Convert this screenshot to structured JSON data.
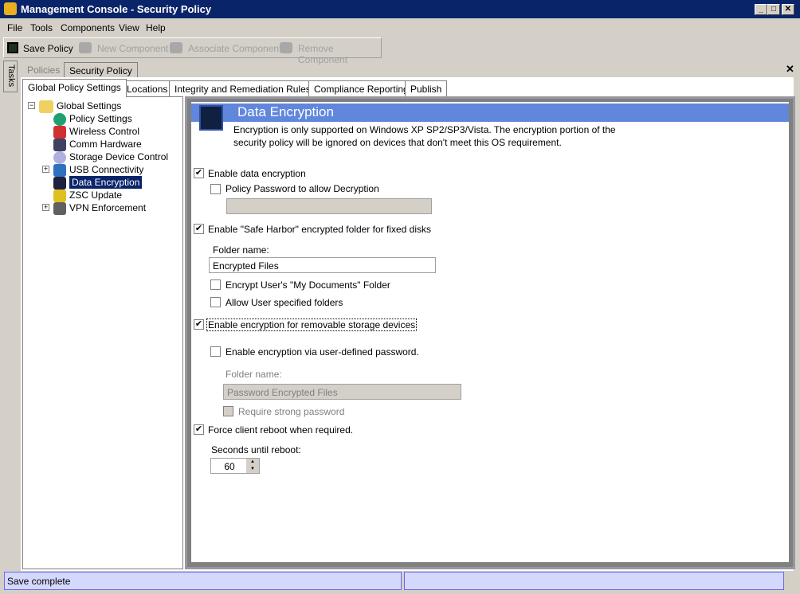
{
  "window": {
    "title": "Management Console - Security Policy"
  },
  "menu": [
    "File",
    "Tools",
    "Components",
    "View",
    "Help"
  ],
  "toolbar": {
    "save": "Save Policy",
    "new": "New Component",
    "associate": "Associate Component",
    "remove": "Remove Component"
  },
  "tasks_label": "Tasks",
  "doc_tabs": [
    "Policies",
    "Security Policy"
  ],
  "sub_tabs": [
    "Global Policy Settings",
    "Locations",
    "Integrity and Remediation Rules",
    "Compliance Reporting",
    "Publish"
  ],
  "tree": {
    "root": "Global Settings",
    "items": [
      "Policy Settings",
      "Wireless Control",
      "Comm Hardware",
      "Storage Device Control",
      "USB Connectivity",
      "Data Encryption",
      "ZSC Update",
      "VPN Enforcement"
    ],
    "selected": "Data Encryption"
  },
  "content": {
    "title": "Data Encryption",
    "desc1": "Encryption is only supported on Windows XP SP2/SP3/Vista. The encryption portion of the",
    "desc2": "security policy will be ignored on devices that don't meet this OS requirement.",
    "enable_data": "Enable data encryption",
    "policy_pw": "Policy Password to allow Decryption",
    "safe_harbor": "Enable \"Safe Harbor\" encrypted folder for fixed disks",
    "folder_label": "Folder name:",
    "folder_value": "Encrypted Files",
    "my_docs": "Encrypt User's \"My Documents\" Folder",
    "user_folders": "Allow User specified folders",
    "removable": "Enable encryption for removable storage devices",
    "user_pw": "Enable encryption via user-defined password.",
    "folder2_label": "Folder name:",
    "folder2_value": "Password Encrypted Files",
    "strong_pw": "Require strong password",
    "force_reboot": "Force client reboot when required.",
    "seconds_label": "Seconds until reboot:",
    "seconds_value": "60",
    "check": "✔"
  },
  "status": {
    "text": "Save complete"
  }
}
